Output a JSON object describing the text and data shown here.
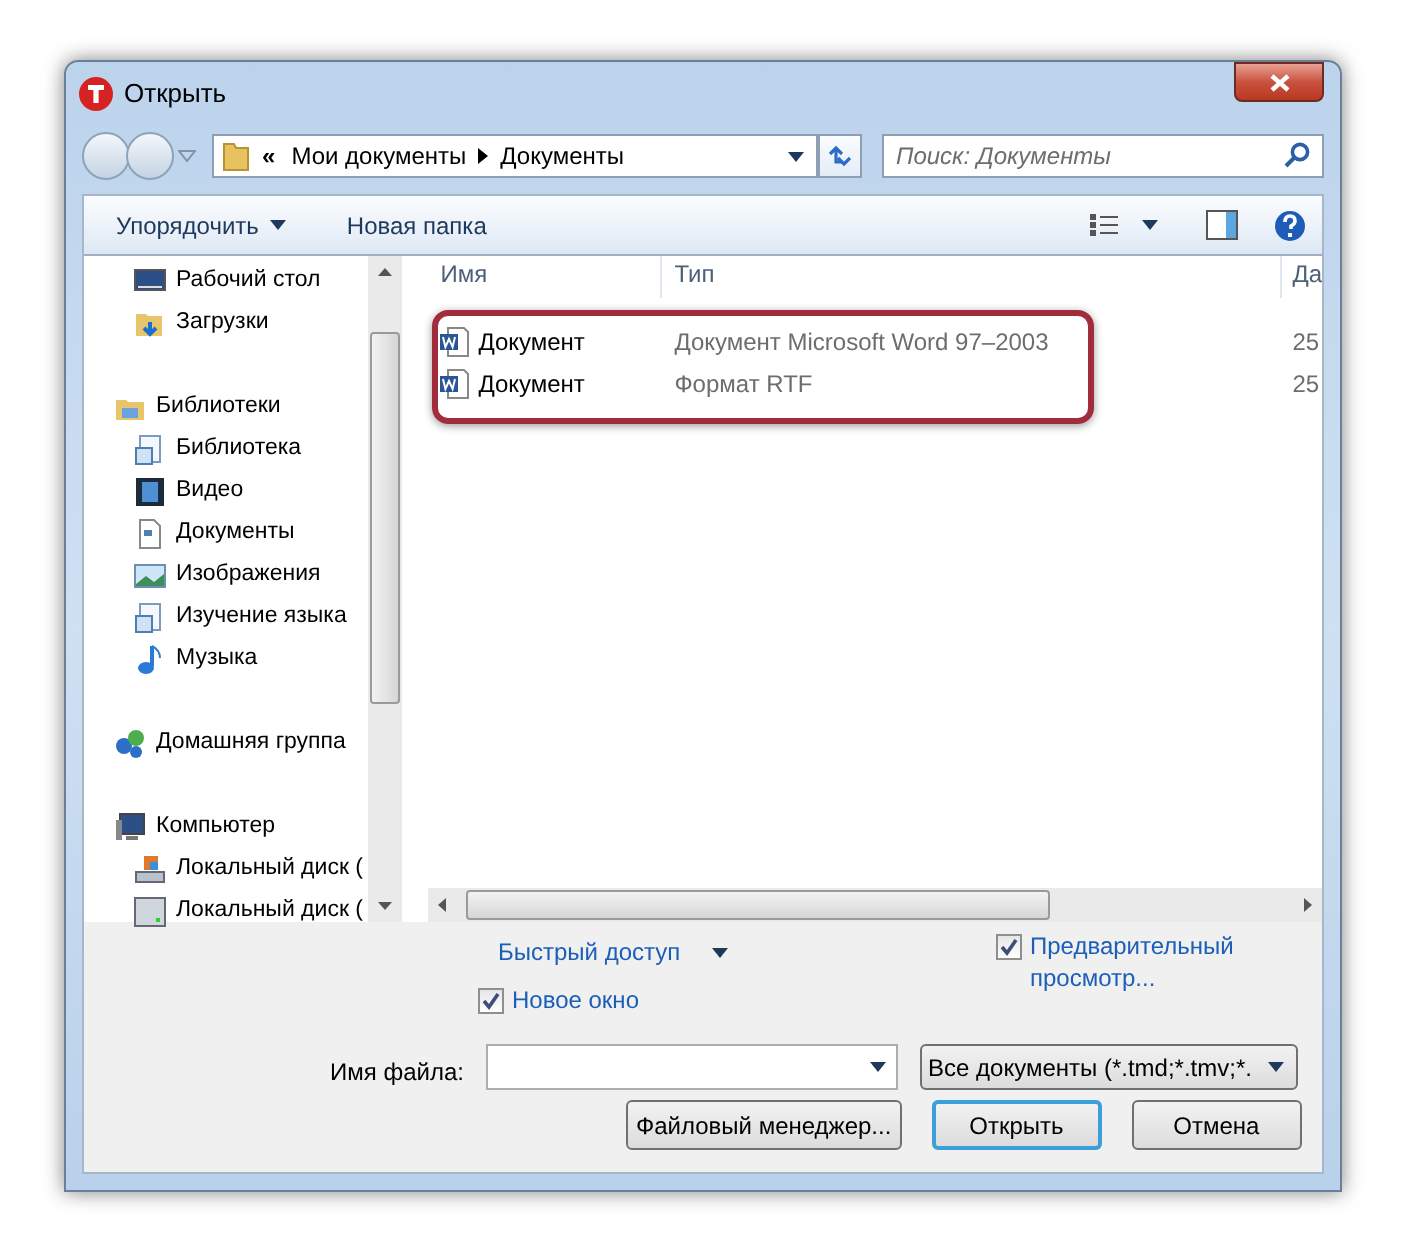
{
  "window": {
    "title": "Открыть"
  },
  "address": {
    "overflow": "«",
    "crumbs": [
      "Мои документы",
      "Документы"
    ]
  },
  "search": {
    "placeholder": "Поиск: Документы"
  },
  "toolbar": {
    "organize": "Упорядочить",
    "new_folder": "Новая папка"
  },
  "nav": [
    {
      "children": [
        {
          "label": "Рабочий стол",
          "kind": "desktop"
        },
        {
          "label": "Загрузки",
          "kind": "downloads"
        }
      ]
    },
    {
      "label": "Библиотеки",
      "kind": "libraries",
      "children": [
        {
          "label": "Библиотека",
          "kind": "library"
        },
        {
          "label": "Видео",
          "kind": "video"
        },
        {
          "label": "Документы",
          "kind": "documents"
        },
        {
          "label": "Изображения",
          "kind": "images"
        },
        {
          "label": "Изучение языка",
          "kind": "library"
        },
        {
          "label": "Музыка",
          "kind": "music"
        }
      ]
    },
    {
      "label": "Домашняя группа",
      "kind": "homegroup"
    },
    {
      "label": "Компьютер",
      "kind": "computer",
      "children": [
        {
          "label": "Локальный диск (",
          "kind": "system-disk"
        },
        {
          "label": "Локальный диск (",
          "kind": "disk"
        }
      ]
    }
  ],
  "files": {
    "columns": [
      "Имя",
      "Тип",
      "Да"
    ],
    "rows": [
      {
        "name": "Документ",
        "type": "Документ Microsoft Word 97–2003",
        "date": "25"
      },
      {
        "name": "Документ",
        "type": "Формат RTF",
        "date": "25"
      }
    ]
  },
  "quick_access": "Быстрый доступ",
  "new_window": {
    "label": "Новое окно",
    "checked": true
  },
  "preview": {
    "label": "Предварительный просмотр...",
    "checked": true
  },
  "filename": {
    "label": "Имя файла:"
  },
  "filetype": {
    "value": "Все документы (*.tmd;*.tmv;*."
  },
  "buttons": [
    {
      "label": "Файловый менеджер...",
      "default": false
    },
    {
      "label": "Открыть",
      "default": true
    },
    {
      "label": "Отмена",
      "default": false
    }
  ]
}
